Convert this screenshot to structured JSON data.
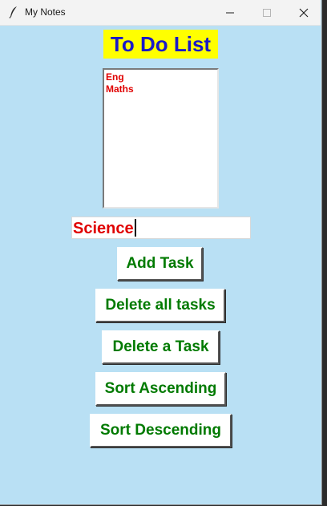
{
  "window": {
    "title": "My Notes",
    "icon": "feather-pen-icon",
    "controls": [
      "minimize-icon",
      "maximize-icon",
      "close-icon"
    ]
  },
  "app": {
    "heading": "To Do List",
    "list": {
      "items": [
        "Eng",
        "Maths"
      ]
    },
    "entry": {
      "value": "Science"
    },
    "buttons": {
      "add": "Add Task",
      "delete_all": "Delete all tasks",
      "delete_one": "Delete a Task",
      "sort_asc": "Sort Ascending",
      "sort_desc": "Sort Descending"
    }
  },
  "colors": {
    "window_bg": "#b9e0f4",
    "heading_bg": "#ffff00",
    "heading_text": "#1919c8",
    "list_text": "#e00000",
    "entry_text": "#e00000",
    "button_text": "#007a00"
  }
}
